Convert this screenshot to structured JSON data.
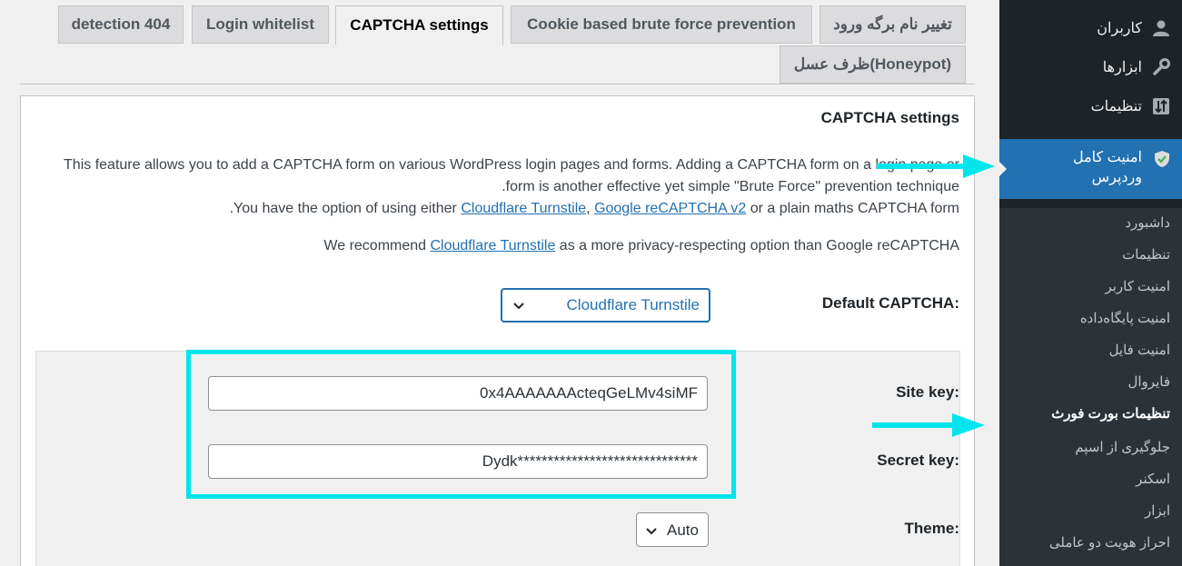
{
  "tabs": [
    {
      "label": "detection 404"
    },
    {
      "label": "Login whitelist"
    },
    {
      "label": "CAPTCHA settings"
    },
    {
      "label": "Cookie based brute force prevention"
    },
    {
      "label": "تغییر نام برگه ورود"
    },
    {
      "label": "ظرف عسل(Honeypot)"
    }
  ],
  "sidebar": {
    "items": [
      {
        "label": "کاربران",
        "icon": "user-icon"
      },
      {
        "label": "ابزارها",
        "icon": "wrench-icon"
      },
      {
        "label": "تنظیمات",
        "icon": "settings-icon"
      }
    ],
    "active": {
      "label_line1": "امنیت کامل",
      "label_line2": "وردپرس",
      "icon": "shield-icon"
    },
    "submenu": [
      {
        "label": "داشبورد"
      },
      {
        "label": "تنظیمات"
      },
      {
        "label": "امنیت کاربر"
      },
      {
        "label": "امنیت پایگاه‌داده"
      },
      {
        "label": "امنیت فایل"
      },
      {
        "label": "فایروال"
      },
      {
        "label": "تنظیمات بورت فورث"
      },
      {
        "label": "جلوگیری از اسپم"
      },
      {
        "label": "اسکنر"
      },
      {
        "label": "ابزار"
      },
      {
        "label": "احراز هویت دو عاملی"
      }
    ]
  },
  "panel": {
    "title": "CAPTCHA settings",
    "desc1": "This feature allows you to add a CAPTCHA form on various WordPress login pages and forms. Adding a CAPTCHA form on a login page or",
    "desc2": ".form is another effective yet simple \"Brute Force\" prevention technique",
    "desc3_pre": ".You have the option of using either ",
    "desc3_link1": "Cloudflare Turnstile",
    "desc3_sep": ", ",
    "desc3_link2": "Google reCAPTCHA v2",
    "desc3_post": " or a plain maths CAPTCHA form",
    "rec_pre": "We recommend ",
    "rec_link": "Cloudflare Turnstile",
    "rec_post": " as a more privacy-respecting option than Google reCAPTCHA",
    "default_captcha_label": "Default CAPTCHA:",
    "default_captcha_value": "Cloudflare Turnstile",
    "site_key_label": "Site key:",
    "site_key_value": "0x4AAAAAAActeqGeLMv4siMF",
    "secret_key_label": "Secret key:",
    "secret_key_value": "Dydk******************************",
    "theme_label": "Theme:",
    "theme_value": "Auto"
  },
  "colors": {
    "accent": "#2271b1",
    "sidebar_bg": "#1d2327",
    "highlight": "#00e5ec"
  }
}
